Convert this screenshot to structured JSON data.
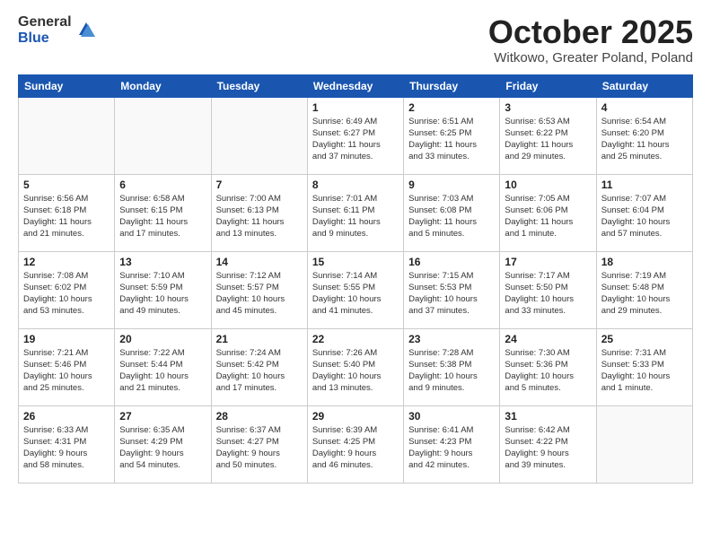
{
  "logo": {
    "general": "General",
    "blue": "Blue"
  },
  "title": "October 2025",
  "location": "Witkowo, Greater Poland, Poland",
  "weekdays": [
    "Sunday",
    "Monday",
    "Tuesday",
    "Wednesday",
    "Thursday",
    "Friday",
    "Saturday"
  ],
  "weeks": [
    [
      {
        "day": "",
        "info": ""
      },
      {
        "day": "",
        "info": ""
      },
      {
        "day": "",
        "info": ""
      },
      {
        "day": "1",
        "info": "Sunrise: 6:49 AM\nSunset: 6:27 PM\nDaylight: 11 hours\nand 37 minutes."
      },
      {
        "day": "2",
        "info": "Sunrise: 6:51 AM\nSunset: 6:25 PM\nDaylight: 11 hours\nand 33 minutes."
      },
      {
        "day": "3",
        "info": "Sunrise: 6:53 AM\nSunset: 6:22 PM\nDaylight: 11 hours\nand 29 minutes."
      },
      {
        "day": "4",
        "info": "Sunrise: 6:54 AM\nSunset: 6:20 PM\nDaylight: 11 hours\nand 25 minutes."
      }
    ],
    [
      {
        "day": "5",
        "info": "Sunrise: 6:56 AM\nSunset: 6:18 PM\nDaylight: 11 hours\nand 21 minutes."
      },
      {
        "day": "6",
        "info": "Sunrise: 6:58 AM\nSunset: 6:15 PM\nDaylight: 11 hours\nand 17 minutes."
      },
      {
        "day": "7",
        "info": "Sunrise: 7:00 AM\nSunset: 6:13 PM\nDaylight: 11 hours\nand 13 minutes."
      },
      {
        "day": "8",
        "info": "Sunrise: 7:01 AM\nSunset: 6:11 PM\nDaylight: 11 hours\nand 9 minutes."
      },
      {
        "day": "9",
        "info": "Sunrise: 7:03 AM\nSunset: 6:08 PM\nDaylight: 11 hours\nand 5 minutes."
      },
      {
        "day": "10",
        "info": "Sunrise: 7:05 AM\nSunset: 6:06 PM\nDaylight: 11 hours\nand 1 minute."
      },
      {
        "day": "11",
        "info": "Sunrise: 7:07 AM\nSunset: 6:04 PM\nDaylight: 10 hours\nand 57 minutes."
      }
    ],
    [
      {
        "day": "12",
        "info": "Sunrise: 7:08 AM\nSunset: 6:02 PM\nDaylight: 10 hours\nand 53 minutes."
      },
      {
        "day": "13",
        "info": "Sunrise: 7:10 AM\nSunset: 5:59 PM\nDaylight: 10 hours\nand 49 minutes."
      },
      {
        "day": "14",
        "info": "Sunrise: 7:12 AM\nSunset: 5:57 PM\nDaylight: 10 hours\nand 45 minutes."
      },
      {
        "day": "15",
        "info": "Sunrise: 7:14 AM\nSunset: 5:55 PM\nDaylight: 10 hours\nand 41 minutes."
      },
      {
        "day": "16",
        "info": "Sunrise: 7:15 AM\nSunset: 5:53 PM\nDaylight: 10 hours\nand 37 minutes."
      },
      {
        "day": "17",
        "info": "Sunrise: 7:17 AM\nSunset: 5:50 PM\nDaylight: 10 hours\nand 33 minutes."
      },
      {
        "day": "18",
        "info": "Sunrise: 7:19 AM\nSunset: 5:48 PM\nDaylight: 10 hours\nand 29 minutes."
      }
    ],
    [
      {
        "day": "19",
        "info": "Sunrise: 7:21 AM\nSunset: 5:46 PM\nDaylight: 10 hours\nand 25 minutes."
      },
      {
        "day": "20",
        "info": "Sunrise: 7:22 AM\nSunset: 5:44 PM\nDaylight: 10 hours\nand 21 minutes."
      },
      {
        "day": "21",
        "info": "Sunrise: 7:24 AM\nSunset: 5:42 PM\nDaylight: 10 hours\nand 17 minutes."
      },
      {
        "day": "22",
        "info": "Sunrise: 7:26 AM\nSunset: 5:40 PM\nDaylight: 10 hours\nand 13 minutes."
      },
      {
        "day": "23",
        "info": "Sunrise: 7:28 AM\nSunset: 5:38 PM\nDaylight: 10 hours\nand 9 minutes."
      },
      {
        "day": "24",
        "info": "Sunrise: 7:30 AM\nSunset: 5:36 PM\nDaylight: 10 hours\nand 5 minutes."
      },
      {
        "day": "25",
        "info": "Sunrise: 7:31 AM\nSunset: 5:33 PM\nDaylight: 10 hours\nand 1 minute."
      }
    ],
    [
      {
        "day": "26",
        "info": "Sunrise: 6:33 AM\nSunset: 4:31 PM\nDaylight: 9 hours\nand 58 minutes."
      },
      {
        "day": "27",
        "info": "Sunrise: 6:35 AM\nSunset: 4:29 PM\nDaylight: 9 hours\nand 54 minutes."
      },
      {
        "day": "28",
        "info": "Sunrise: 6:37 AM\nSunset: 4:27 PM\nDaylight: 9 hours\nand 50 minutes."
      },
      {
        "day": "29",
        "info": "Sunrise: 6:39 AM\nSunset: 4:25 PM\nDaylight: 9 hours\nand 46 minutes."
      },
      {
        "day": "30",
        "info": "Sunrise: 6:41 AM\nSunset: 4:23 PM\nDaylight: 9 hours\nand 42 minutes."
      },
      {
        "day": "31",
        "info": "Sunrise: 6:42 AM\nSunset: 4:22 PM\nDaylight: 9 hours\nand 39 minutes."
      },
      {
        "day": "",
        "info": ""
      }
    ]
  ]
}
